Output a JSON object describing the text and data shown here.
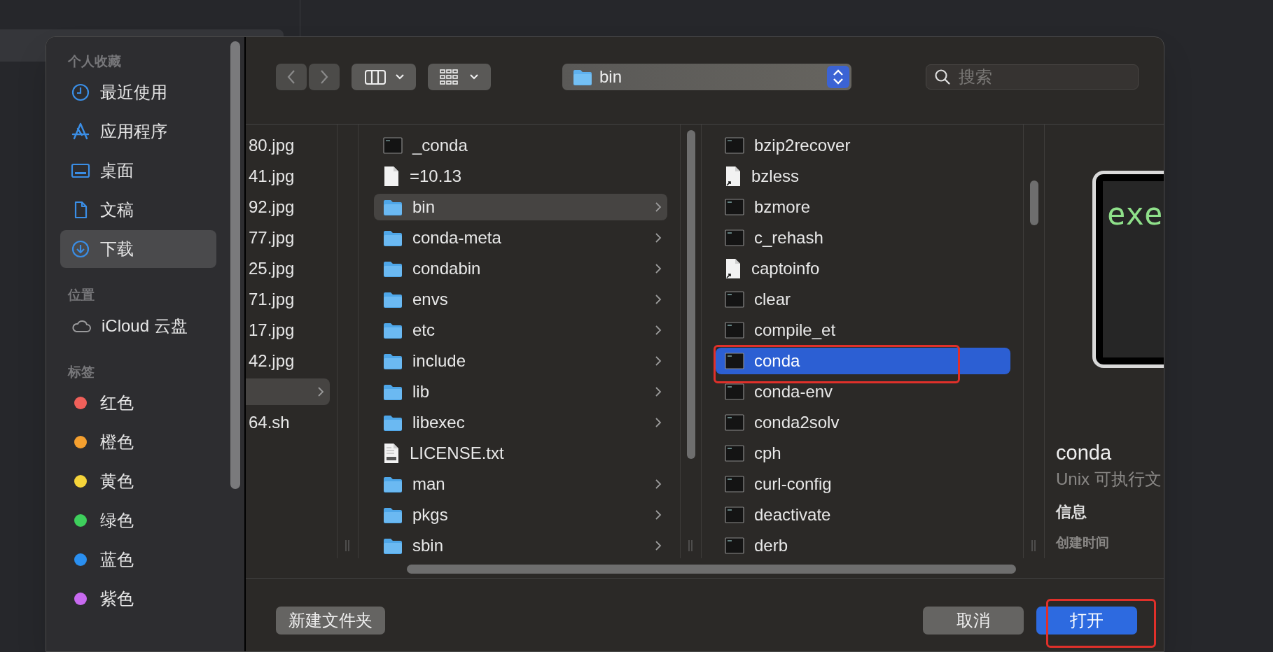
{
  "sidebar": {
    "sections": [
      {
        "title": "个人收藏",
        "items": [
          {
            "kind": "place",
            "label": "最近使用",
            "selected": false
          },
          {
            "kind": "place",
            "label": "应用程序",
            "selected": false
          },
          {
            "kind": "place",
            "label": "桌面",
            "selected": false
          },
          {
            "kind": "place",
            "label": "文稿",
            "selected": false
          },
          {
            "kind": "place",
            "label": "下载",
            "selected": true
          }
        ]
      },
      {
        "title": "位置",
        "items": [
          {
            "kind": "cloud",
            "label": "iCloud 云盘",
            "selected": false
          }
        ]
      },
      {
        "title": "标签",
        "items": [
          {
            "kind": "tag",
            "label": "红色",
            "color": "#f0605a",
            "selected": false
          },
          {
            "kind": "tag",
            "label": "橙色",
            "color": "#f5a02f",
            "selected": false
          },
          {
            "kind": "tag",
            "label": "黄色",
            "color": "#f5d43a",
            "selected": false
          },
          {
            "kind": "tag",
            "label": "绿色",
            "color": "#3ecf5c",
            "selected": false
          },
          {
            "kind": "tag",
            "label": "蓝色",
            "color": "#2a8ff0",
            "selected": false
          },
          {
            "kind": "tag",
            "label": "紫色",
            "color": "#c86af0",
            "selected": false
          }
        ]
      }
    ]
  },
  "toolbar": {
    "path": "bin",
    "search": {
      "placeholder": "搜索"
    }
  },
  "columns": [
    {
      "active": false,
      "rows": [
        {
          "kind": "file",
          "name": "80.jpg",
          "selected": false,
          "expandable": false
        },
        {
          "kind": "file",
          "name": "41.jpg",
          "selected": false,
          "expandable": false
        },
        {
          "kind": "file",
          "name": "92.jpg",
          "selected": false,
          "expandable": false
        },
        {
          "kind": "file",
          "name": "77.jpg",
          "selected": false,
          "expandable": false
        },
        {
          "kind": "file",
          "name": "25.jpg",
          "selected": false,
          "expandable": false
        },
        {
          "kind": "file",
          "name": "71.jpg",
          "selected": false,
          "expandable": false
        },
        {
          "kind": "file",
          "name": "17.jpg",
          "selected": false,
          "expandable": false
        },
        {
          "kind": "file",
          "name": "42.jpg",
          "selected": false,
          "expandable": false
        },
        {
          "kind": "file",
          "selected": true,
          "expandable": true
        },
        {
          "kind": "file",
          "name": "64.sh",
          "selected": false,
          "expandable": false
        }
      ]
    },
    {
      "active": false,
      "rows": [
        {
          "kind": "exec",
          "name": "_conda",
          "selected": false,
          "expandable": false
        },
        {
          "kind": "document",
          "name": "=10.13",
          "selected": false,
          "expandable": false
        },
        {
          "kind": "folder",
          "name": "bin",
          "selected": true,
          "expandable": true
        },
        {
          "kind": "folder",
          "name": "conda-meta",
          "selected": false,
          "expandable": true
        },
        {
          "kind": "folder",
          "name": "condabin",
          "selected": false,
          "expandable": true
        },
        {
          "kind": "folder",
          "name": "envs",
          "selected": false,
          "expandable": true
        },
        {
          "kind": "folder",
          "name": "etc",
          "selected": false,
          "expandable": true
        },
        {
          "kind": "folder",
          "name": "include",
          "selected": false,
          "expandable": true
        },
        {
          "kind": "folder",
          "name": "lib",
          "selected": false,
          "expandable": true
        },
        {
          "kind": "folder",
          "name": "libexec",
          "selected": false,
          "expandable": true
        },
        {
          "kind": "text",
          "name": "LICENSE.txt",
          "selected": false,
          "expandable": false
        },
        {
          "kind": "folder",
          "name": "man",
          "selected": false,
          "expandable": true
        },
        {
          "kind": "folder",
          "name": "pkgs",
          "selected": false,
          "expandable": true
        },
        {
          "kind": "folder",
          "name": "sbin",
          "selected": false,
          "expandable": true
        }
      ]
    },
    {
      "active": true,
      "rows": [
        {
          "kind": "exec",
          "name": "bzip2recover",
          "selected": false,
          "expandable": false
        },
        {
          "kind": "alias",
          "name": "bzless",
          "selected": false,
          "expandable": false
        },
        {
          "kind": "exec",
          "name": "bzmore",
          "selected": false,
          "expandable": false
        },
        {
          "kind": "exec",
          "name": "c_rehash",
          "selected": false,
          "expandable": false
        },
        {
          "kind": "alias",
          "name": "captoinfo",
          "selected": false,
          "expandable": false
        },
        {
          "kind": "exec",
          "name": "clear",
          "selected": false,
          "expandable": false
        },
        {
          "kind": "exec",
          "name": "compile_et",
          "selected": false,
          "expandable": false
        },
        {
          "kind": "exec",
          "name": "conda",
          "selected": true,
          "expandable": false
        },
        {
          "kind": "exec",
          "name": "conda-env",
          "selected": false,
          "expandable": false
        },
        {
          "kind": "exec",
          "name": "conda2solv",
          "selected": false,
          "expandable": false
        },
        {
          "kind": "exec",
          "name": "cph",
          "selected": false,
          "expandable": false
        },
        {
          "kind": "exec",
          "name": "curl-config",
          "selected": false,
          "expandable": false
        },
        {
          "kind": "exec",
          "name": "deactivate",
          "selected": false,
          "expandable": false
        },
        {
          "kind": "exec",
          "name": "derb",
          "selected": false,
          "expandable": false
        }
      ]
    }
  ],
  "preview": {
    "icon_text": "exe",
    "name": "conda",
    "type": "Unix 可执行文",
    "info_heading": "信息",
    "field_label": "创建时间"
  },
  "buttons": [
    {
      "kind": "secondary",
      "label": "新建文件夹"
    },
    {
      "kind": "secondary",
      "label": "取消"
    },
    {
      "kind": "primary",
      "label": "打开"
    }
  ]
}
